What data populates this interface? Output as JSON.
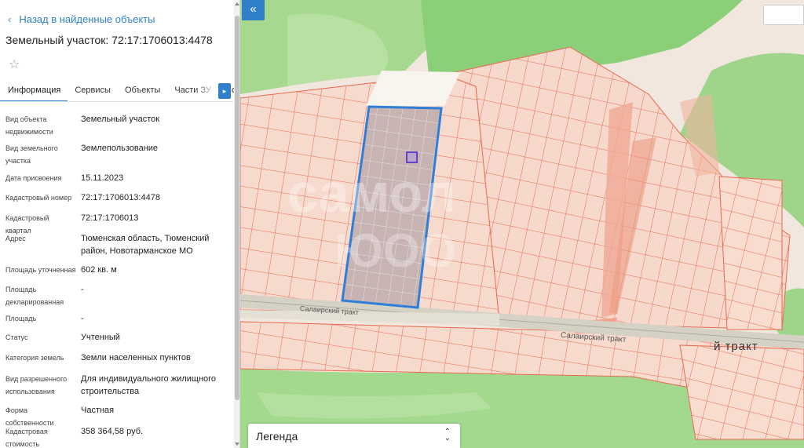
{
  "panel": {
    "back_link": "Назад в найденные объекты",
    "title": "Земельный участок: 72:17:1706013:4478",
    "tabs": [
      "Информация",
      "Сервисы",
      "Объекты",
      "Части ЗУ",
      "Соста"
    ],
    "rows": [
      {
        "label": "Вид объекта недвижимости",
        "value": "Земельный участок"
      },
      {
        "label": "Вид земельного участка",
        "value": "Землепользование"
      },
      {
        "label": "Дата присвоения",
        "value": "15.11.2023"
      },
      {
        "label": "Кадастровый номер",
        "value": "72:17:1706013:4478"
      },
      {
        "label": "Кадастровый квартал",
        "value": "72:17:1706013"
      },
      {
        "label": "Адрес",
        "value": "Тюменская область, Тюменский район, Новотарманское МО"
      },
      {
        "label": "Площадь уточненная",
        "value": "602 кв. м"
      },
      {
        "label": "Площадь декларированная",
        "value": "-"
      },
      {
        "label": "Площадь",
        "value": "-"
      },
      {
        "label": "Статус",
        "value": "Учтенный"
      },
      {
        "label": "Категория земель",
        "value": "Земли населенных пунктов"
      },
      {
        "label": "Вид разрешенного использования",
        "value": "Для индивидуального жилищного строительства"
      },
      {
        "label": "Форма собственности",
        "value": "Частная"
      },
      {
        "label": "Кадастровая стоимость",
        "value": "358 364,58 руб."
      }
    ]
  },
  "map": {
    "collapse_symbol": "«",
    "legend_label": "Легенда",
    "road_label_small_1": "Салаирский тракт",
    "road_label_small_2": "Салаирский тракт",
    "road_label_large": "й тракт",
    "colors": {
      "parcel_stroke": "#e8694f",
      "parcel_fill": "#f6d9cc",
      "forest": "#9fd58b",
      "forest_dark": "#8ccf79",
      "selection": "#2f7fd9",
      "road": "#d8d4c8"
    }
  }
}
